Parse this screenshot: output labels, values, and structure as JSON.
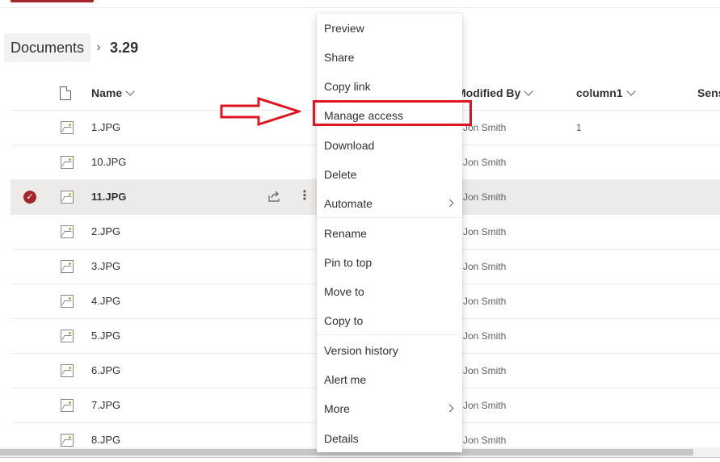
{
  "breadcrumb": {
    "root": "Documents",
    "separator": "›",
    "current": "3.29"
  },
  "columns": {
    "name": "Name",
    "modified_by": "Modified By",
    "column1": "column1",
    "sensitivity": "Sens"
  },
  "files": [
    {
      "name": "1.JPG",
      "modified_by": "Jon Smith",
      "column1": "1",
      "selected": false
    },
    {
      "name": "10.JPG",
      "modified_by": "Jon Smith",
      "column1": "",
      "selected": false
    },
    {
      "name": "11.JPG",
      "modified_by": "Jon Smith",
      "column1": "",
      "selected": true
    },
    {
      "name": "2.JPG",
      "modified_by": "Jon Smith",
      "column1": "",
      "selected": false
    },
    {
      "name": "3.JPG",
      "modified_by": "Jon Smith",
      "column1": "",
      "selected": false
    },
    {
      "name": "4.JPG",
      "modified_by": "Jon Smith",
      "column1": "",
      "selected": false
    },
    {
      "name": "5.JPG",
      "modified_by": "Jon Smith",
      "column1": "",
      "selected": false
    },
    {
      "name": "6.JPG",
      "modified_by": "Jon Smith",
      "column1": "",
      "selected": false
    },
    {
      "name": "7.JPG",
      "modified_by": "Jon Smith",
      "column1": "",
      "selected": false
    },
    {
      "name": "8.JPG",
      "modified_by": "Jon Smith",
      "column1": "",
      "selected": false
    }
  ],
  "context_menu": {
    "items": [
      {
        "label": "Preview"
      },
      {
        "label": "Share"
      },
      {
        "label": "Copy link"
      },
      {
        "label": "Manage access",
        "highlighted": true
      },
      {
        "label": "Download"
      },
      {
        "label": "Delete"
      },
      {
        "label": "Automate",
        "submenu": true
      },
      {
        "label": "Rename"
      },
      {
        "label": "Pin to top"
      },
      {
        "label": "Move to"
      },
      {
        "label": "Copy to"
      },
      {
        "label": "Version history"
      },
      {
        "label": "Alert me"
      },
      {
        "label": "More",
        "submenu": true
      },
      {
        "label": "Details"
      }
    ]
  },
  "annotation": {
    "box_color": "#e0141e",
    "arrow_color": "#e0141e"
  },
  "colors": {
    "accent": "#a4262c",
    "selected_row": "#edebe9"
  }
}
